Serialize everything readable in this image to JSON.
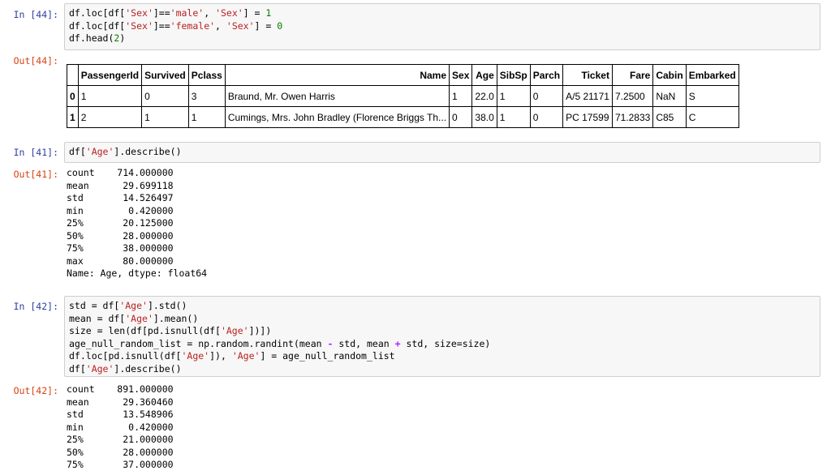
{
  "cells": {
    "c44": {
      "in_prompt": "In [44]:",
      "code": [
        [
          "df.loc[df[",
          {
            "s": "'Sex'"
          },
          "]==",
          {
            "s": "'male'"
          },
          ", ",
          {
            "s": "'Sex'"
          },
          "] = ",
          {
            "n": "1"
          }
        ],
        [
          "df.loc[df[",
          {
            "s": "'Sex'"
          },
          "]==",
          {
            "s": "'female'"
          },
          ", ",
          {
            "s": "'Sex'"
          },
          "] = ",
          {
            "n": "0"
          }
        ],
        [
          "df.head(",
          {
            "n": "2"
          },
          ")"
        ]
      ],
      "out_prompt": "Out[44]:",
      "table": {
        "columns": [
          "PassengerId",
          "Survived",
          "Pclass",
          "Name",
          "Sex",
          "Age",
          "SibSp",
          "Parch",
          "Ticket",
          "Fare",
          "Cabin",
          "Embarked"
        ],
        "rows": [
          [
            "0",
            "1",
            "0",
            "3",
            "Braund, Mr. Owen Harris",
            "1",
            "22.0",
            "1",
            "0",
            "A/5 21171",
            "7.2500",
            "NaN",
            "S"
          ],
          [
            "1",
            "2",
            "1",
            "1",
            "Cumings, Mrs. John Bradley (Florence Briggs Th...",
            "0",
            "38.0",
            "1",
            "0",
            "PC 17599",
            "71.2833",
            "C85",
            "C"
          ]
        ]
      }
    },
    "c41": {
      "in_prompt": "In [41]:",
      "code": [
        [
          "df[",
          {
            "s": "'Age'"
          },
          "].describe()"
        ]
      ],
      "out_prompt": "Out[41]:",
      "output": [
        "count    714.000000",
        "mean      29.699118",
        "std       14.526497",
        "min        0.420000",
        "25%       20.125000",
        "50%       28.000000",
        "75%       38.000000",
        "max       80.000000",
        "Name: Age, dtype: float64"
      ]
    },
    "c42": {
      "in_prompt": "In [42]:",
      "code": [
        [
          "std = df[",
          {
            "s": "'Age'"
          },
          "].std()"
        ],
        [
          "mean = df[",
          {
            "s": "'Age'"
          },
          "].mean()"
        ],
        [
          "size = len(df[pd.isnull(df[",
          {
            "s": "'Age'"
          },
          "])])"
        ],
        [
          "age_null_random_list = np.random.randint(mean ",
          {
            "o": "-"
          },
          " std, mean ",
          {
            "o": "+"
          },
          " std, size=size)"
        ],
        [
          "df.loc[pd.isnull(df[",
          {
            "s": "'Age'"
          },
          "]), ",
          {
            "s": "'Age'"
          },
          "] = age_null_random_list"
        ],
        [
          "df[",
          {
            "s": "'Age'"
          },
          "].describe()"
        ]
      ],
      "out_prompt": "Out[42]:",
      "output": [
        "count    891.000000",
        "mean      29.360460",
        "std       13.548906",
        "min        0.420000",
        "25%       21.000000",
        "50%       28.000000",
        "75%       37.000000"
      ]
    }
  }
}
